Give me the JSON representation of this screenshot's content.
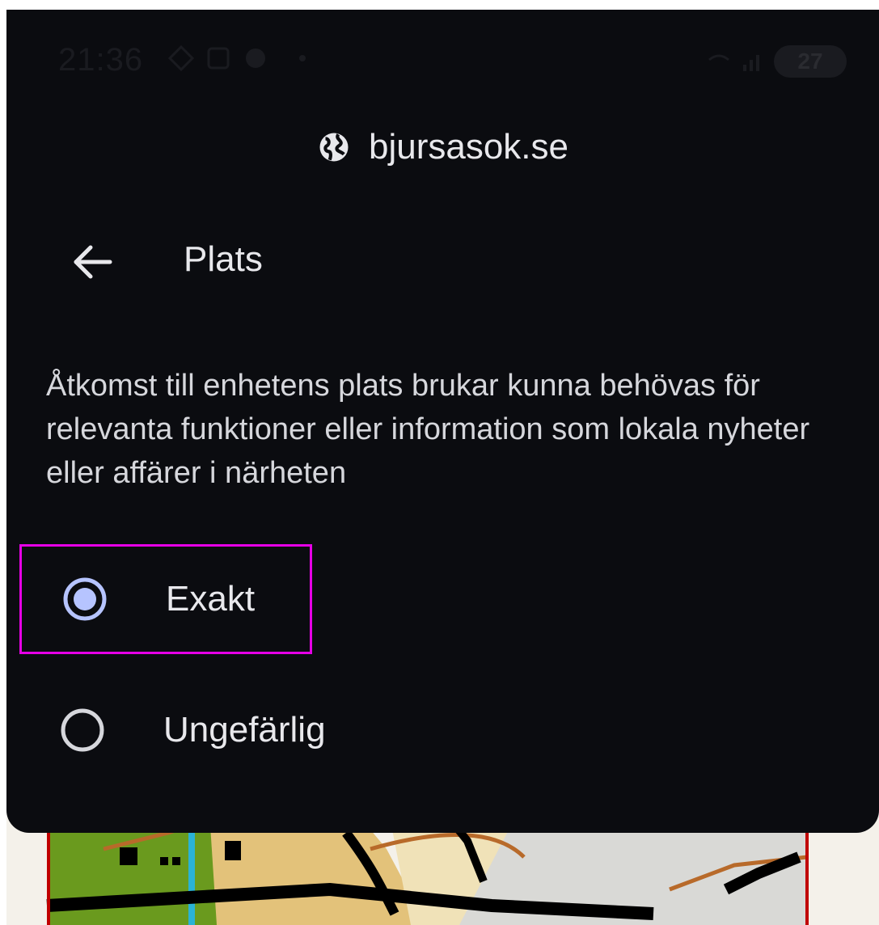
{
  "status_bar": {
    "time": "21:36",
    "battery": "27",
    "icons_left": [
      "diamond-grid-icon",
      "screenshot-icon",
      "half-circle-icon",
      "dot-icon"
    ],
    "icons_right": [
      "wifi-icon",
      "signal-icon",
      "battery-charging-icon"
    ]
  },
  "sheet": {
    "site": "bjursasok.se",
    "site_icon": "globe-icon",
    "title": "Plats",
    "back_icon": "back-arrow-icon",
    "description": "Åtkomst till enhetens plats brukar kunna behövas för relevanta funktioner eller information som lokala nyheter eller affärer i närheten",
    "options": [
      {
        "label": "Exakt",
        "selected": true
      },
      {
        "label": "Ungefärlig",
        "selected": false
      }
    ]
  },
  "colors": {
    "sheet_bg": "#0b0c10",
    "text": "#e8e8ec",
    "radio_selected": "#b6c4ff",
    "highlight": "#e600e6"
  }
}
